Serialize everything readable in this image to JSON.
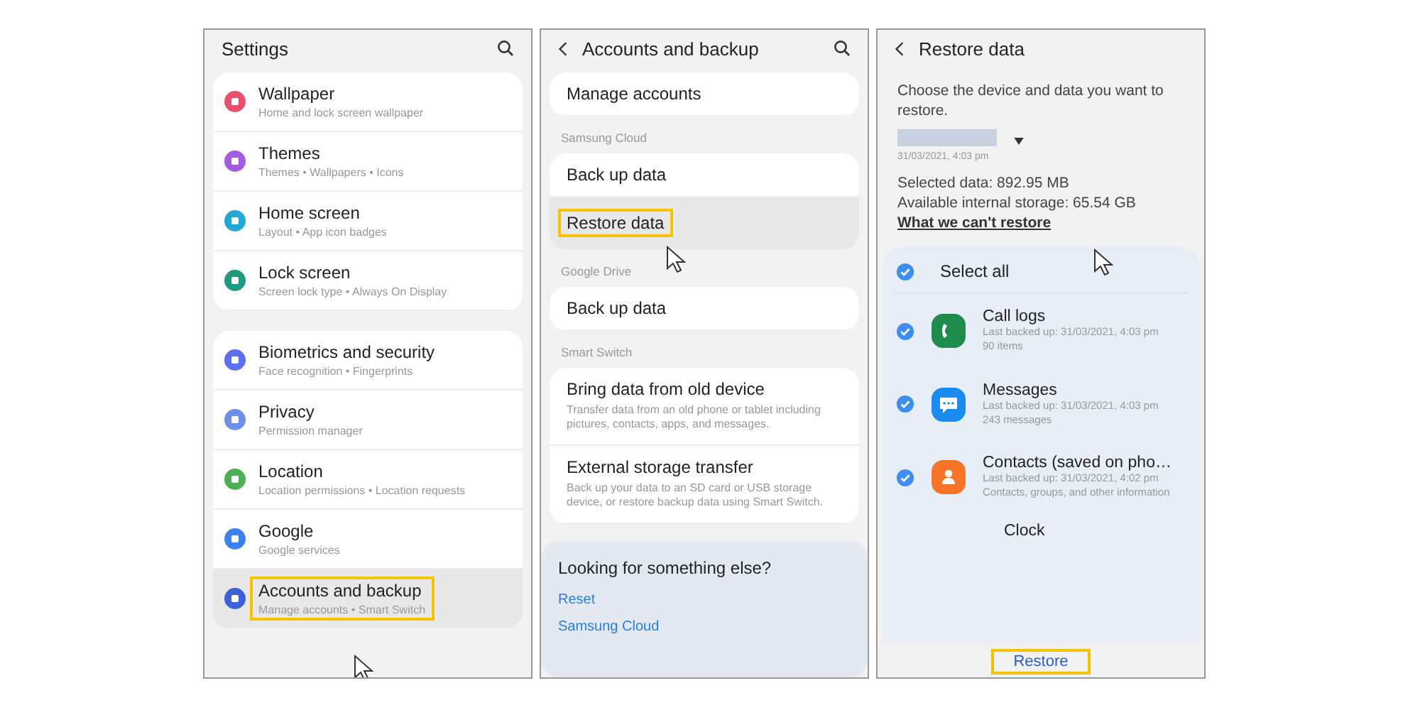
{
  "settings": {
    "title": "Settings",
    "groups": [
      {
        "items": [
          {
            "title": "Wallpaper",
            "subtitle": "Home and lock screen wallpaper",
            "color": "#e8506e",
            "selected": false
          },
          {
            "title": "Themes",
            "subtitle": "Themes  •  Wallpapers  •  Icons",
            "color": "#a55be0",
            "selected": false
          },
          {
            "title": "Home screen",
            "subtitle": "Layout  •  App icon badges",
            "color": "#1fa8d8",
            "selected": false
          },
          {
            "title": "Lock screen",
            "subtitle": "Screen lock type  •  Always On Display",
            "color": "#1f9a80",
            "selected": false
          }
        ]
      },
      {
        "items": [
          {
            "title": "Biometrics and security",
            "subtitle": "Face recognition  •  Fingerprints",
            "color": "#5b6ff0",
            "selected": false
          },
          {
            "title": "Privacy",
            "subtitle": "Permission manager",
            "color": "#6f8ee8",
            "selected": false
          },
          {
            "title": "Location",
            "subtitle": "Location permissions  •  Location requests",
            "color": "#4caf50",
            "selected": false
          },
          {
            "title": "Google",
            "subtitle": "Google services",
            "color": "#3b82f0",
            "selected": false
          },
          {
            "title": "Accounts and backup",
            "subtitle": "Manage accounts  •  Smart Switch",
            "color": "#3d5fd8",
            "selected": true
          }
        ]
      }
    ]
  },
  "accounts": {
    "title": "Accounts and backup",
    "sections": [
      {
        "items": [
          {
            "title": "Manage accounts",
            "selected": false
          }
        ]
      },
      {
        "header": "Samsung Cloud",
        "items": [
          {
            "title": "Back up data",
            "selected": false
          },
          {
            "title": "Restore data",
            "selected": true
          }
        ]
      },
      {
        "header": "Google Drive",
        "items": [
          {
            "title": "Back up data",
            "selected": false
          }
        ]
      },
      {
        "header": "Smart Switch",
        "items": [
          {
            "title": "Bring data from old device",
            "description": "Transfer data from an old phone or tablet including pictures, contacts, apps, and messages.",
            "selected": false
          },
          {
            "title": "External storage transfer",
            "description": "Back up your data to an SD card or USB storage device, or restore backup data using Smart Switch.",
            "selected": false
          }
        ]
      }
    ],
    "suggestions": {
      "title": "Looking for something else?",
      "links": [
        "Reset",
        "Samsung Cloud"
      ]
    }
  },
  "restore": {
    "title": "Restore data",
    "description": "Choose the device and data you want to restore.",
    "device": {
      "date": "31/03/2021, 4:03 pm"
    },
    "selected_data": "Selected data: 892.95 MB",
    "available_storage": "Available internal storage: 65.54 GB",
    "link": "What we can't restore",
    "select_all": {
      "label": "Select all",
      "checked": true
    },
    "items": [
      {
        "title": "Call logs",
        "details": [
          "Last backed up: 31/03/2021, 4:03 pm",
          "90 items"
        ],
        "checked": true,
        "color": "#1e8a4c"
      },
      {
        "title": "Messages",
        "details": [
          "Last backed up: 31/03/2021, 4:03 pm",
          "243 messages"
        ],
        "checked": true,
        "color": "#1a8cf0"
      },
      {
        "title": "Contacts (saved on pho…",
        "details": [
          "Last backed up: 31/03/2021, 4:02 pm",
          "Contacts, groups, and other information"
        ],
        "checked": true,
        "color": "#f57428"
      }
    ],
    "partial_item": "Clock",
    "button": {
      "label": "Restore",
      "highlighted": true
    }
  }
}
